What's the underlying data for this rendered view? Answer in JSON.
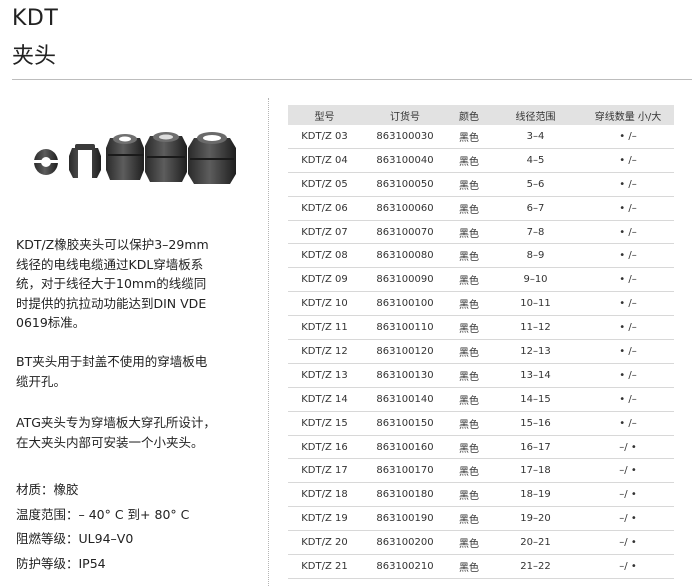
{
  "header": {
    "title_en": "KDT",
    "title_cn": "夹头"
  },
  "description": {
    "p1_lines": [
      "KDT/Z橡胶夹头可以保护3–29mm",
      "线径的电线电缆通过KDL穿墙板系",
      "统，对于线径大于10mm的线缆同",
      "时提供的抗拉动功能达到DIN VDE",
      "0619标准。"
    ],
    "p2_lines": [
      "BT夹头用于封盖不使用的穿墙板电",
      "缆开孔。"
    ],
    "p3_lines": [
      "ATG夹头专为穿墙板大穿孔所设计，",
      "在大夹头内部可安装一个小夹头。"
    ]
  },
  "specs": {
    "material": "材质：橡胶",
    "temp": "温度范围：– 40°  C 到+ 80°  C",
    "flame": "阻燃等级：UL94–V0",
    "protection": "防护等级：IP54"
  },
  "table": {
    "headers": [
      "型号",
      "订货号",
      "颜色",
      "线径范围",
      "穿线数量  小/大"
    ],
    "rows": [
      [
        "KDT/Z 03",
        "863100030",
        "黑色",
        "3–4",
        "• /–"
      ],
      [
        "KDT/Z 04",
        "863100040",
        "黑色",
        "4–5",
        "• /–"
      ],
      [
        "KDT/Z 05",
        "863100050",
        "黑色",
        "5–6",
        "• /–"
      ],
      [
        "KDT/Z 06",
        "863100060",
        "黑色",
        "6–7",
        "• /–"
      ],
      [
        "KDT/Z 07",
        "863100070",
        "黑色",
        "7–8",
        "• /–"
      ],
      [
        "KDT/Z 08",
        "863100080",
        "黑色",
        "8–9",
        "• /–"
      ],
      [
        "KDT/Z 09",
        "863100090",
        "黑色",
        "9–10",
        "• /–"
      ],
      [
        "KDT/Z 10",
        "863100100",
        "黑色",
        "10–11",
        "• /–"
      ],
      [
        "KDT/Z 11",
        "863100110",
        "黑色",
        "11–12",
        "• /–"
      ],
      [
        "KDT/Z 12",
        "863100120",
        "黑色",
        "12–13",
        "• /–"
      ],
      [
        "KDT/Z 13",
        "863100130",
        "黑色",
        "13–14",
        "• /–"
      ],
      [
        "KDT/Z 14",
        "863100140",
        "黑色",
        "14–15",
        "• /–"
      ],
      [
        "KDT/Z 15",
        "863100150",
        "黑色",
        "15–16",
        "• /–"
      ],
      [
        "KDT/Z 16",
        "863100160",
        "黑色",
        "16–17",
        "–/ •"
      ],
      [
        "KDT/Z 17",
        "863100170",
        "黑色",
        "17–18",
        "–/ •"
      ],
      [
        "KDT/Z 18",
        "863100180",
        "黑色",
        "18–19",
        "–/ •"
      ],
      [
        "KDT/Z 19",
        "863100190",
        "黑色",
        "19–20",
        "–/ •"
      ],
      [
        "KDT/Z 20",
        "863100200",
        "黑色",
        "20–21",
        "–/ •"
      ],
      [
        "KDT/Z 21",
        "863100210",
        "黑色",
        "21–22",
        "–/ •"
      ]
    ]
  }
}
